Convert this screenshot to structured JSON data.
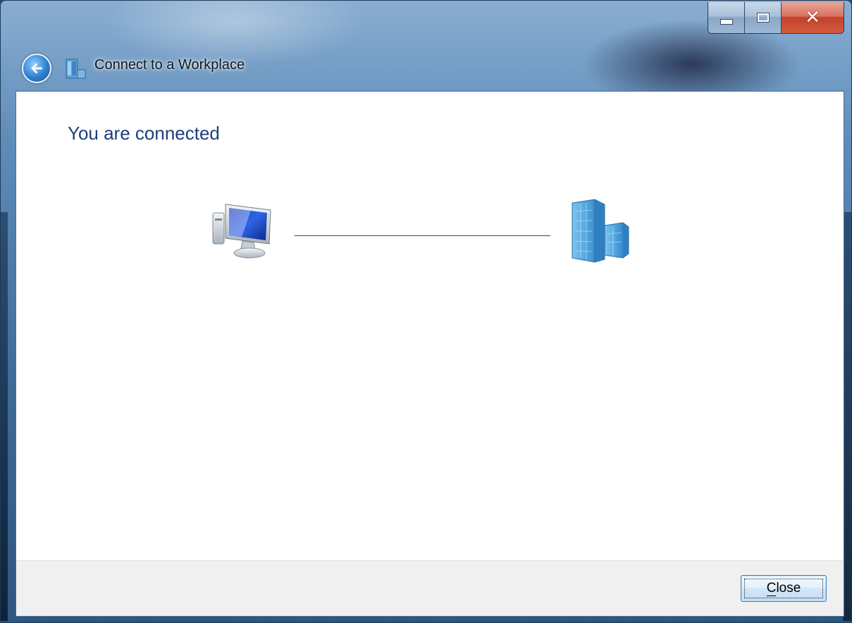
{
  "window": {
    "title": "Connect to a Workplace",
    "caption_buttons": {
      "minimize": "minimize-icon",
      "maximize": "maximize-icon",
      "close": "close-icon"
    }
  },
  "main": {
    "heading": "You are connected",
    "connection": {
      "left_icon": "computer-icon",
      "right_icon": "workplace-network-icon",
      "status": "connected"
    }
  },
  "footer": {
    "close_button": {
      "accesskey_char": "C",
      "label_rest": "lose"
    }
  },
  "colors": {
    "heading": "#1e3e7b",
    "title_bar": "#5f8db9"
  }
}
